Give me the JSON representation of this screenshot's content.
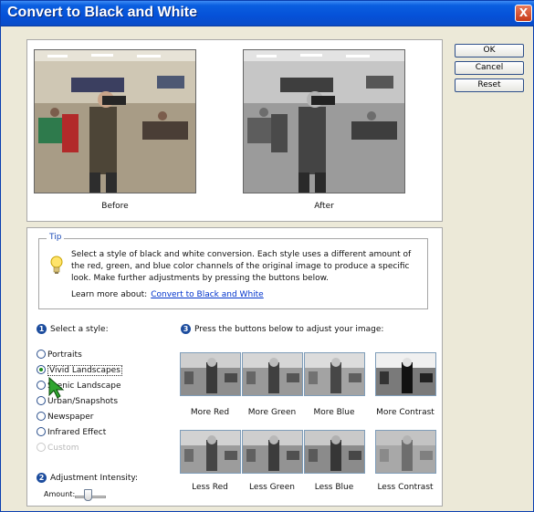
{
  "window": {
    "title": "Convert to Black and White",
    "close_symbol": "X"
  },
  "buttons": {
    "ok": "OK",
    "cancel": "Cancel",
    "reset": "Reset"
  },
  "preview": {
    "before_label": "Before",
    "after_label": "After"
  },
  "tip": {
    "legend": "Tip",
    "text": "Select a style of black and white conversion. Each style uses a different amount of the red, green, and blue color channels of the original image to produce a specific look. Make further adjustments by pressing the buttons below.",
    "learn_prefix": "Learn more about:",
    "learn_link": "Convert to Black and White"
  },
  "styles": {
    "step": "1",
    "title": "Select a style:",
    "selected": "Vivid Landscapes",
    "items": [
      {
        "label": "Portraits",
        "state": "normal"
      },
      {
        "label": "Vivid Landscapes",
        "state": "checked"
      },
      {
        "label": "Scenic Landscape",
        "state": "normal"
      },
      {
        "label": "Urban/Snapshots",
        "state": "normal"
      },
      {
        "label": "Newspaper",
        "state": "normal"
      },
      {
        "label": "Infrared Effect",
        "state": "normal"
      },
      {
        "label": "Custom",
        "state": "disabled"
      }
    ]
  },
  "adjust": {
    "step": "3",
    "title": "Press the buttons below to adjust your image:",
    "row1": [
      "More Red",
      "More Green",
      "More Blue",
      "More Contrast"
    ],
    "row2": [
      "Less Red",
      "Less Green",
      "Less Blue",
      "Less Contrast"
    ]
  },
  "intensity": {
    "step": "2",
    "title": "Adjustment Intensity:",
    "amount_label": "Amount:"
  },
  "colors": {
    "title_bar": "#0551d8",
    "step_badge": "#1d4d9e",
    "link": "#0033cc",
    "window_bg": "#ece9d8"
  },
  "icons": {
    "tip": "lightbulb-icon",
    "close": "close-icon",
    "cursor": "pointer-cursor-icon"
  }
}
